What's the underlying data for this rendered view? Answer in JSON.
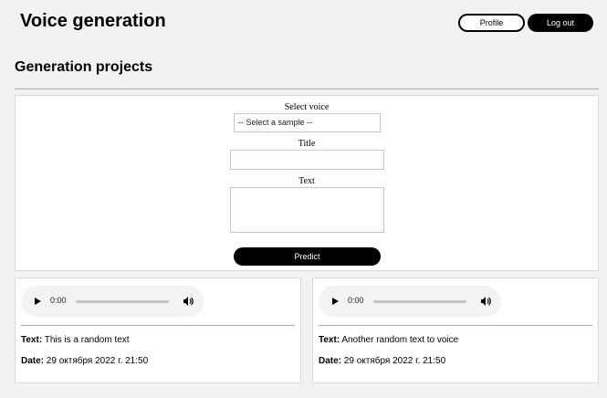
{
  "header": {
    "title": "Voice generation",
    "profile_label": "Profile",
    "logout_label": "Log out"
  },
  "section": {
    "title": "Generation projects"
  },
  "form": {
    "voice_label": "Select voice",
    "voice_selected": "-- Select a sample --",
    "title_label": "Title",
    "title_value": "",
    "text_label": "Text",
    "text_value": "",
    "predict_label": "Predict"
  },
  "cards": [
    {
      "audio_time": "0:00",
      "text_label": "Text:",
      "text_value": "This is a random text",
      "date_label": "Date:",
      "date_value": "29 октября 2022 г. 21:50"
    },
    {
      "audio_time": "0:00",
      "text_label": "Text:",
      "text_value": "Another random text to voice",
      "date_label": "Date:",
      "date_value": "29 октября 2022 г. 21:50"
    }
  ],
  "icons": {
    "play": "play-icon",
    "volume": "volume-icon"
  }
}
